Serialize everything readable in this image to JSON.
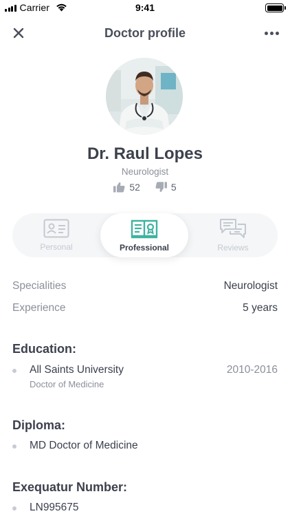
{
  "status_bar": {
    "carrier": "Carrier",
    "time": "9:41"
  },
  "nav": {
    "title": "Doctor profile",
    "close_icon": "close-icon",
    "more_icon": "more-horizontal-icon"
  },
  "doctor": {
    "name": "Dr. Raul Lopes",
    "specialty": "Neurologist",
    "likes": "52",
    "dislikes": "5"
  },
  "tabs": [
    {
      "label": "Personal",
      "icon": "id-card-icon",
      "active": false
    },
    {
      "label": "Professional",
      "icon": "book-icon",
      "active": true
    },
    {
      "label": "Reviews",
      "icon": "chat-bubbles-icon",
      "active": false
    }
  ],
  "info": [
    {
      "label": "Specialities",
      "value": "Neurologist"
    },
    {
      "label": "Experience",
      "value": "5 years"
    }
  ],
  "education": {
    "title": "Education:",
    "items": [
      {
        "school": "All Saints University",
        "degree": "Doctor of Medicine",
        "years": "2010-2016"
      }
    ]
  },
  "diploma": {
    "title": "Diploma:",
    "items": [
      {
        "text": "MD Doctor of Medicine"
      }
    ]
  },
  "exequatur": {
    "title": "Exequatur Number:",
    "items": [
      {
        "text": "LN995675"
      }
    ]
  },
  "colors": {
    "accent": "#3fb2a0",
    "text_primary": "#3a3f4c",
    "text_secondary": "#8b8f9a",
    "tab_bg": "#f4f6f8"
  }
}
